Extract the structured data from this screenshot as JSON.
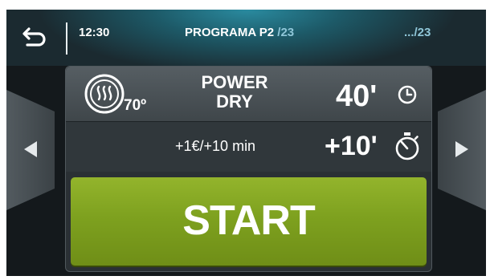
{
  "header": {
    "time": "12:30",
    "program_prefix": "PROGRAMA P2",
    "program_count": " /23",
    "page_left": "...",
    "page_right": "/23"
  },
  "program": {
    "name_line1": "POWER",
    "name_line2": "DRY",
    "temperature": "70º",
    "duration": "40'"
  },
  "extra": {
    "price": "+1€/+10 min",
    "time": "+10'"
  },
  "start": {
    "label": "START"
  },
  "icons": {
    "back": "back-arrow-icon",
    "prev": "left-triangle-icon",
    "next": "right-triangle-icon",
    "dry": "tumble-dry-icon",
    "clock": "clock-icon",
    "stopwatch": "stopwatch-icon"
  },
  "colors": {
    "start_green": "#7ea11f",
    "accent_blue": "#8fc6d8",
    "panel": "#2a3034"
  }
}
